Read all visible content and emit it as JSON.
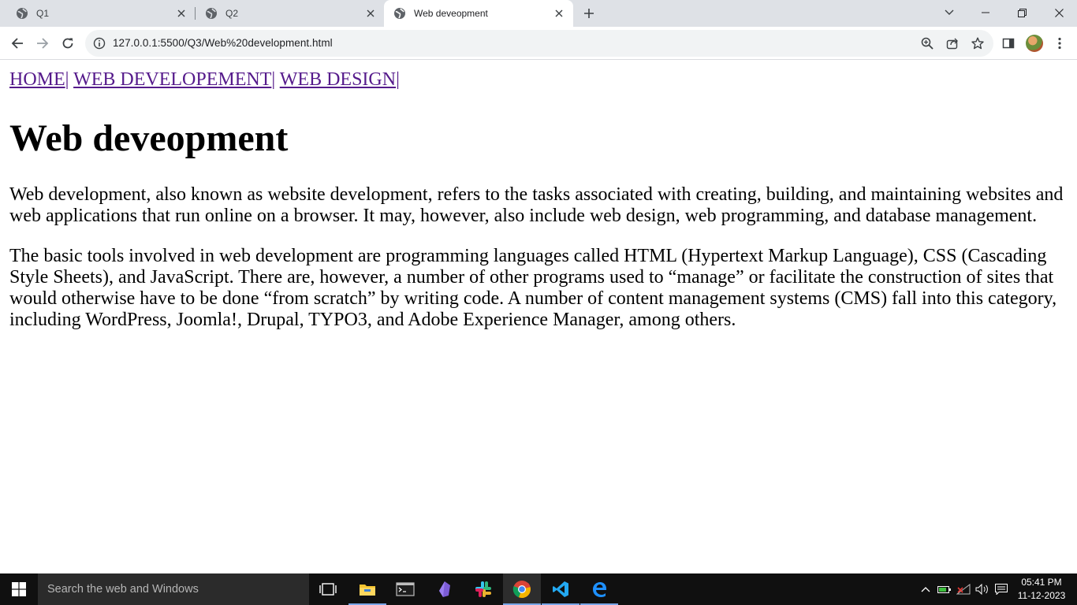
{
  "browser": {
    "tabs": [
      {
        "title": "Q1",
        "active": false
      },
      {
        "title": "Q2",
        "active": false
      },
      {
        "title": "Web deveopment",
        "active": true
      }
    ],
    "url": "127.0.0.1:5500/Q3/Web%20development.html"
  },
  "page": {
    "nav": [
      {
        "label": "HOME",
        "separator": "|"
      },
      {
        "label": "WEB DEVELOPEMENT",
        "separator": "|"
      },
      {
        "label": "WEB DESIGN",
        "separator": "|"
      }
    ],
    "heading": "Web deveopment",
    "paragraphs": [
      "Web development, also known as website development, refers to the tasks associated with creating, building, and maintaining websites and web applications that run online on a browser. It may, however, also include web design, web programming, and database management.",
      "The basic tools involved in web development are programming languages called HTML (Hypertext Markup Language), CSS (Cascading Style Sheets), and JavaScript. There are, however, a number of other programs used to “manage” or facilitate the construction of sites that would otherwise have to be done “from scratch” by writing code. A number of content management systems (CMS) fall into this category, including WordPress, Joomla!, Drupal, TYPO3, and Adobe Experience Manager, among others."
    ],
    "link_color": "#551a8b"
  },
  "taskbar": {
    "search_placeholder": "Search the web and Windows",
    "apps": [
      "task-view-icon",
      "file-explorer-icon",
      "terminal-icon",
      "obsidian-icon",
      "slack-icon",
      "chrome-icon",
      "vscode-icon",
      "edge-icon"
    ],
    "clock": {
      "time": "05:41 PM",
      "date": "11-12-2023"
    }
  }
}
